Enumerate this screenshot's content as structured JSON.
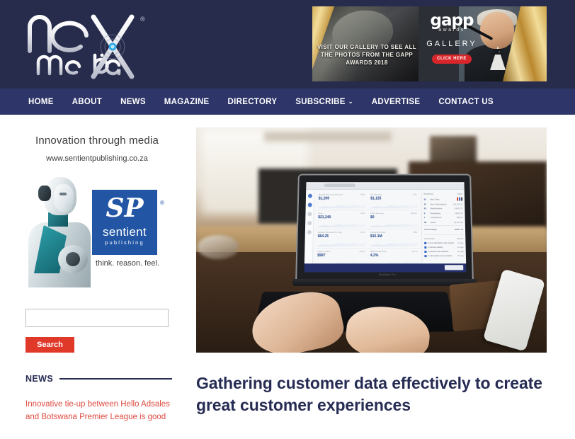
{
  "site": {
    "logo_primary": "nex",
    "logo_secondary": "media",
    "logo_mark": "X",
    "logo_trademark": "®"
  },
  "banner_ad": {
    "headline": "VISIT OUR GALLERY TO SEE ALL THE PHOTOS FROM THE GAPP AWARDS 2018",
    "brand": "gapp",
    "brand_sub": "awards",
    "section_label": "GALLERY",
    "cta": "CLICK HERE",
    "cta_color": "#d8262b"
  },
  "nav": {
    "items": [
      {
        "label": "HOME",
        "has_dropdown": false
      },
      {
        "label": "ABOUT",
        "has_dropdown": false
      },
      {
        "label": "NEWS",
        "has_dropdown": false
      },
      {
        "label": "MAGAZINE",
        "has_dropdown": false
      },
      {
        "label": "DIRECTORY",
        "has_dropdown": false
      },
      {
        "label": "SUBSCRIBE",
        "has_dropdown": true
      },
      {
        "label": "ADVERTISE",
        "has_dropdown": false
      },
      {
        "label": "CONTACT US",
        "has_dropdown": false
      }
    ],
    "dropdown_glyph": "⌄",
    "background": "#2e3568"
  },
  "sidebar": {
    "ad": {
      "tagline": "Innovation through media",
      "url": "www.sentientpublishing.co.za",
      "logo_mark": "SP",
      "logo_name": "sentient",
      "logo_sub": "publishing",
      "logo_trademark": "®",
      "slogan": "think. reason. feel.",
      "brand_color": "#2256a4"
    },
    "search": {
      "value": "",
      "placeholder": "",
      "button_label": "Search",
      "button_color": "#e0392a"
    },
    "news": {
      "title": "NEWS",
      "items": [
        {
          "headline": "Innovative tie-up between Hello Adsales and Botswana Premier League is good"
        }
      ],
      "link_color": "#de4a3f"
    }
  },
  "main": {
    "hero": {
      "alt": "Hands typing on a laptop displaying an analytics dashboard in a cafe",
      "dashboard": {
        "rail_icons": [
          "logo-dot",
          "active-dot",
          "dim-dot",
          "dim-dot",
          "dim-dot"
        ],
        "cards": [
          {
            "label": "Monthly Recurring Revenue",
            "value": "$1,269",
            "delta": "7.04%"
          },
          {
            "label": "Net Revenue",
            "value": "$1,125",
            "delta": "4.1%"
          },
          {
            "label": "Fees",
            "value": "$21,240",
            "delta": "8.4%"
          },
          {
            "label": "Other Revenue",
            "value": "$0",
            "delta": "100.0%"
          },
          {
            "label": "Average Revenue Per User",
            "value": "$64.25",
            "delta": "1.6%"
          },
          {
            "label": "Annual Run Rate",
            "value": "$15.1M",
            "delta": "3.8%"
          },
          {
            "label": "Lifetime Value",
            "value": "$997",
            "delta": "13.0%"
          },
          {
            "label": "MRR Growth Rate",
            "value": "4.2%",
            "delta": "23.7%"
          }
        ],
        "breakdown_title": "Breakdown",
        "breakdown_filter": "Today",
        "breakdown_rows": [
          {
            "count": "33",
            "label": "New Trials",
            "value": ""
          },
          {
            "count": "41",
            "label": "New Subscriptions",
            "value": "+$1,420.11"
          },
          {
            "count": "22",
            "label": "Reactivations",
            "value": "+$602.51"
          },
          {
            "count": "9",
            "label": "Expansions",
            "value": "+$420.40"
          },
          {
            "count": "7",
            "label": "Contractions",
            "value": "-$88.00"
          },
          {
            "count": "48",
            "label": "Churn",
            "value": "-$1,001.64"
          }
        ],
        "total_label": "Total Change",
        "total_value": "+$197.12",
        "activity_title": "Live Stream",
        "activity_filter": "Recent",
        "activity_rows": [
          {
            "text": "A new subscription was created",
            "time": "1m ago"
          },
          {
            "text": "A trial was started",
            "time": "3m ago"
          },
          {
            "text": "A payment was collected",
            "time": "6m ago"
          },
          {
            "text": "A subscription was cancelled",
            "time": "9m ago"
          }
        ],
        "footer_button": "Start Free Trial"
      },
      "laptop_brand": "MacBook Pro"
    },
    "article": {
      "title": "Gathering customer data effectively to create great customer experiences"
    }
  },
  "theme": {
    "header_bg": "#272c4c",
    "nav_bg": "#2e3568",
    "navy": "#262c53",
    "red": "#e0392a"
  }
}
